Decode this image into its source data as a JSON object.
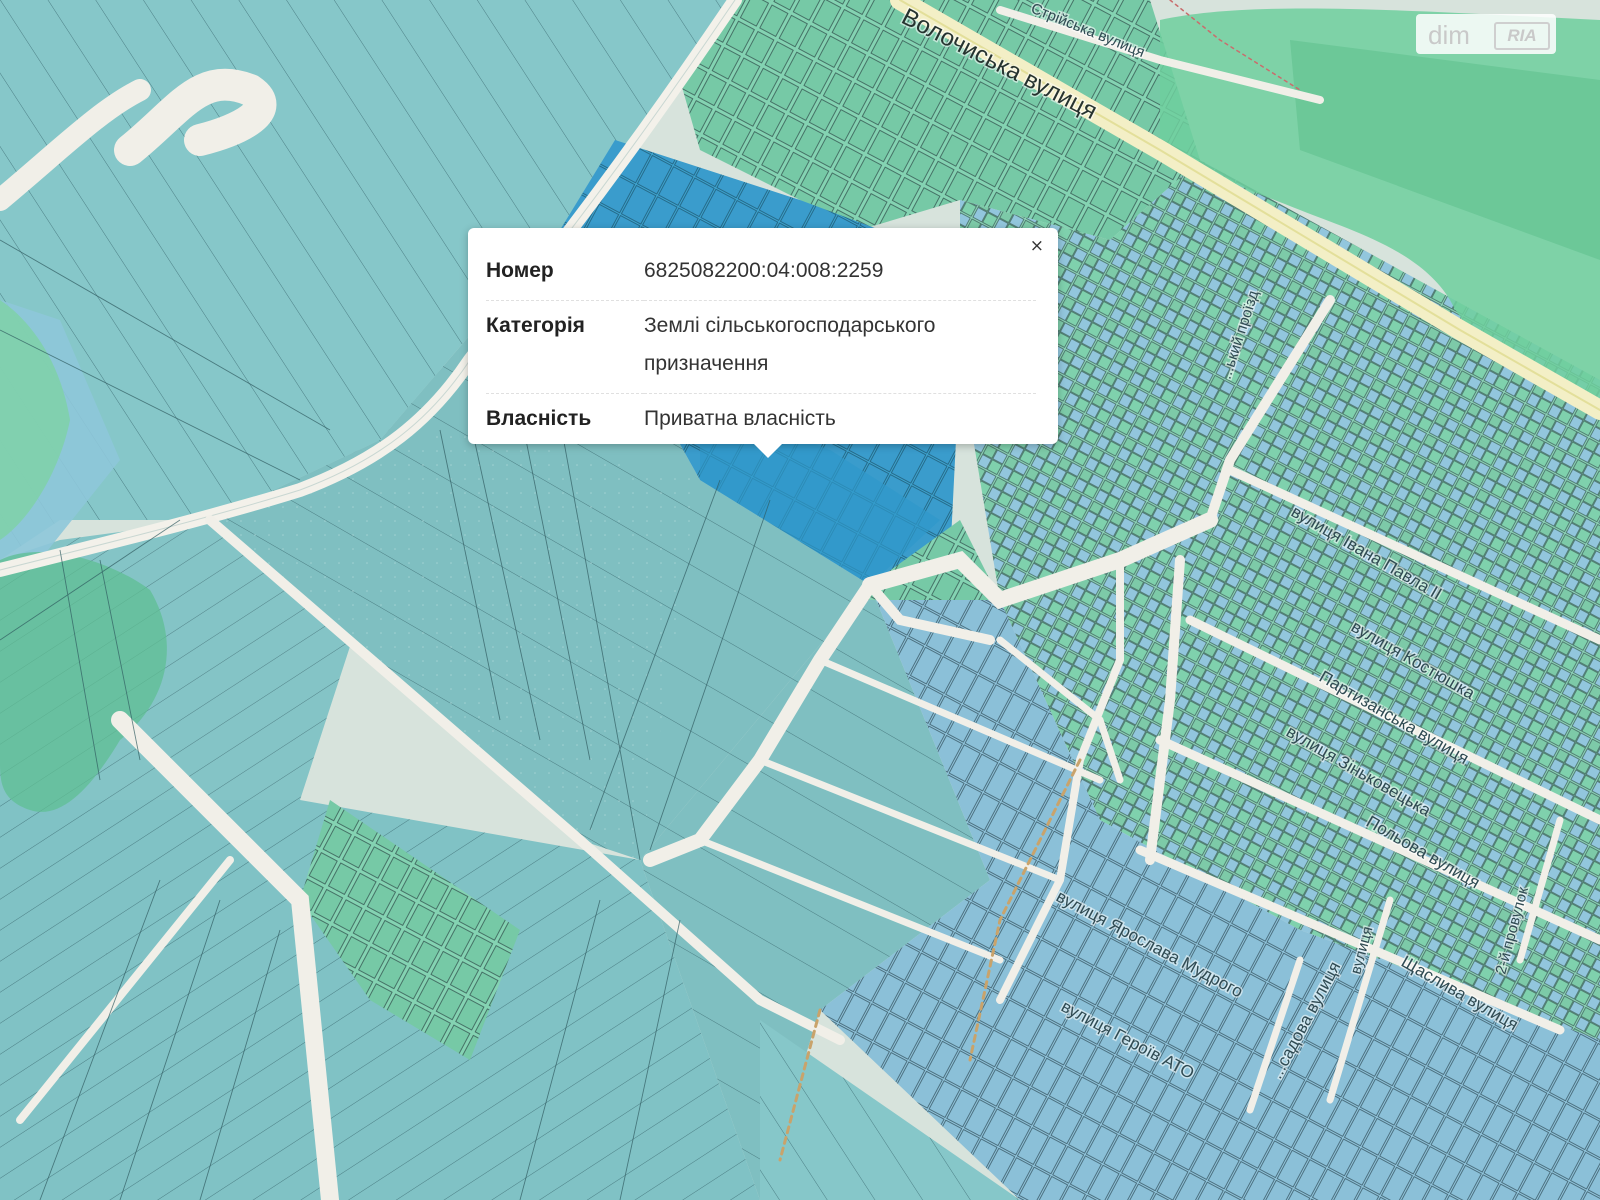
{
  "map": {
    "streets": [
      {
        "id": "volochyska",
        "name": "Волочиська вулиця"
      },
      {
        "id": "striyska",
        "name": "Стрійська вулиця"
      },
      {
        "id": "proizd",
        "name": "...ький проїзд"
      },
      {
        "id": "ivana-pavla",
        "name": "вулиця Івана Павла II"
      },
      {
        "id": "kostiushka",
        "name": "вулиця Костюшка"
      },
      {
        "id": "partyzanska",
        "name": "Партизанська вулиця"
      },
      {
        "id": "zinkovetska",
        "name": "вулиця Зіньковецька"
      },
      {
        "id": "polova",
        "name": "Польова вулиця"
      },
      {
        "id": "proizd2",
        "name": "2-й провулок"
      },
      {
        "id": "yaroslava",
        "name": "вулиця Ярослава Мудрого"
      },
      {
        "id": "heroiv",
        "name": "вулиця Героїв АТО"
      },
      {
        "id": "sadova",
        "name": "...садова вулиця"
      },
      {
        "id": "shchaslyva",
        "name": "Щаслива вулиця"
      },
      {
        "id": "vulytsia-s",
        "name": "вулиця"
      }
    ],
    "colors": {
      "agri": "#86c7c9",
      "agri_alt": "#7dbfc2",
      "residential": "#7fd1ad",
      "residential_light": "#9adcbc",
      "communal": "#8fc3da",
      "selected": "#3ba0cf",
      "road": "#f1efe8",
      "forest": "#74cfa0"
    }
  },
  "popup": {
    "rows": [
      {
        "label": "Номер",
        "value": "6825082200:04:008:2259"
      },
      {
        "label": "Категорія",
        "value": "Землі сільськогосподарського призначення"
      },
      {
        "label": "Власність",
        "value": "Приватна власність"
      }
    ],
    "close_label": "×"
  },
  "logo": {
    "dim": "dim",
    "ria": "RIA"
  }
}
